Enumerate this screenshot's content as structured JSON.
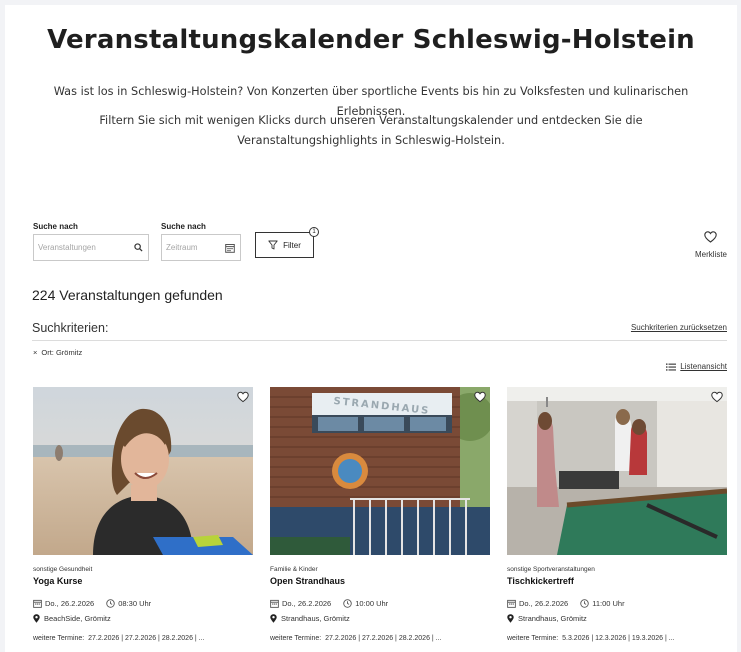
{
  "header": {
    "title": "Veranstaltungskalender Schleswig-Holstein",
    "intro_1": "Was ist los in Schleswig-Holstein? Von Konzerten über sportliche Events bis hin zu Volksfesten und kulinarischen Erlebnissen.",
    "intro_2": "Filtern Sie sich mit wenigen Klicks durch unseren Veranstaltungskalender und entdecken Sie die Veranstaltungshighlights in Schleswig-Holstein."
  },
  "search": {
    "events": {
      "label": "Suche nach",
      "placeholder": "Veranstaltungen",
      "icon": "search-icon"
    },
    "period": {
      "label": "Suche nach",
      "placeholder": "Zeitraum",
      "icon": "calendar-icon"
    },
    "filter_label": "Filter",
    "filter_count": "1",
    "watchlist_label": "Merkliste"
  },
  "results": {
    "count_text": "224 Veranstaltungen gefunden",
    "criteria_title": "Suchkriterien:",
    "reset_label": "Suchkriterien zurücksetzen",
    "active_filter": "Ort: Grömitz",
    "list_view_label": "Listenansicht"
  },
  "cards": [
    {
      "category": "sonstige Gesundheit",
      "title": "Yoga Kurse",
      "date": "Do., 26.2.2026",
      "time": "08:30 Uhr",
      "location": "BeachSide, Grömitz",
      "more_label": "weitere Termine:",
      "more_dates": "27.2.2026 | 27.2.2026 | 28.2.2026 | ..."
    },
    {
      "category": "Familie & Kinder",
      "title": "Open Strandhaus",
      "date": "Do., 26.2.2026",
      "time": "10:00 Uhr",
      "location": "Strandhaus, Grömitz",
      "more_label": "weitere Termine:",
      "more_dates": "27.2.2026 | 27.2.2026 | 28.2.2026 | ...",
      "sign_text": "STRANDHAUS"
    },
    {
      "category": "sonstige Sportveranstaltungen",
      "title": "Tischkickertreff",
      "date": "Do., 26.2.2026",
      "time": "11:00 Uhr",
      "location": "Strandhaus, Grömitz",
      "more_label": "weitere Termine:",
      "more_dates": "5.3.2026 | 12.3.2026 | 19.3.2026 | ..."
    }
  ]
}
